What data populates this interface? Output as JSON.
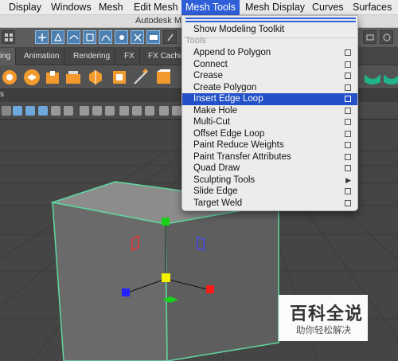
{
  "menubar": {
    "items": [
      "Display",
      "Windows",
      "Mesh",
      "Edit Mesh",
      "Mesh Tools",
      "Mesh Display",
      "Curves",
      "Surfaces"
    ],
    "active_index": 4
  },
  "window": {
    "title": "Autodesk M"
  },
  "shelf_tabs": [
    "ing",
    "Animation",
    "Rendering",
    "FX",
    "FX Caching"
  ],
  "mesh_tools_menu": {
    "top_item": "Show Modeling Toolkit",
    "section_label": "Tools",
    "items": [
      "Append to Polygon",
      "Connect",
      "Crease",
      "Create Polygon",
      "Insert Edge Loop",
      "Make Hole",
      "Multi-Cut",
      "Offset Edge Loop",
      "Paint Reduce Weights",
      "Paint Transfer Attributes",
      "Quad Draw",
      "Sculpting Tools",
      "Slide Edge",
      "Target Weld"
    ],
    "highlighted": "Insert Edge Loop",
    "submenu_item": "Sculpting Tools"
  },
  "panel": {
    "label": "s"
  },
  "watermark": {
    "brand": "百科全说",
    "tagline": "助你轻松解决"
  },
  "colors": {
    "menu_highlight": "#2451c7",
    "menubar_active": "#2f5fd8",
    "cube_edge": "#5fd9a0",
    "viewport_bg": "#444444"
  }
}
